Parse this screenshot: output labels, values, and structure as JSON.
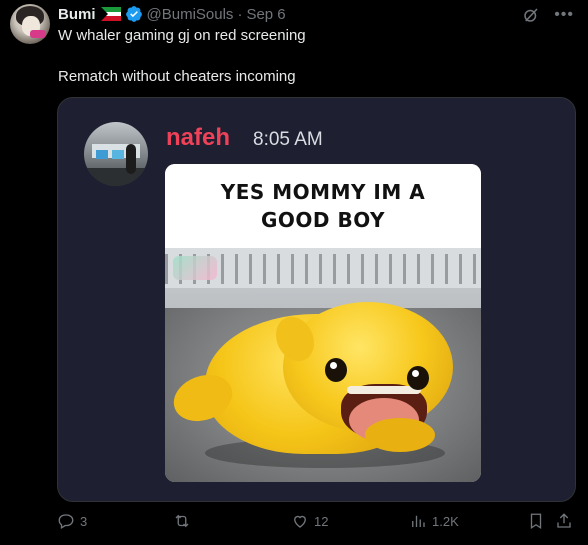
{
  "author": {
    "name": "Bumi",
    "handle": "@BumiSouls",
    "separator": "·",
    "date": "Sep 6",
    "flag_icon": "kuwait-flag",
    "verified_icon": "verified-badge-icon"
  },
  "tweet": {
    "line1": "W whaler gaming gj on red screening",
    "line2": "Rematch without cheaters incoming"
  },
  "embed": {
    "username": "nafeh",
    "time": "8:05 AM",
    "meme_caption_line1": "YES MOMMY IM A",
    "meme_caption_line2": "GOOD BOY"
  },
  "actions": {
    "replies": "3",
    "retweets": "",
    "likes": "12",
    "views": "1.2K"
  },
  "colors": {
    "background": "#000000",
    "text": "#e7e9ea",
    "muted": "#71767b",
    "discord_name": "#ef4158",
    "card_bg": "#1e2031",
    "verified": "#1d9bf0"
  }
}
